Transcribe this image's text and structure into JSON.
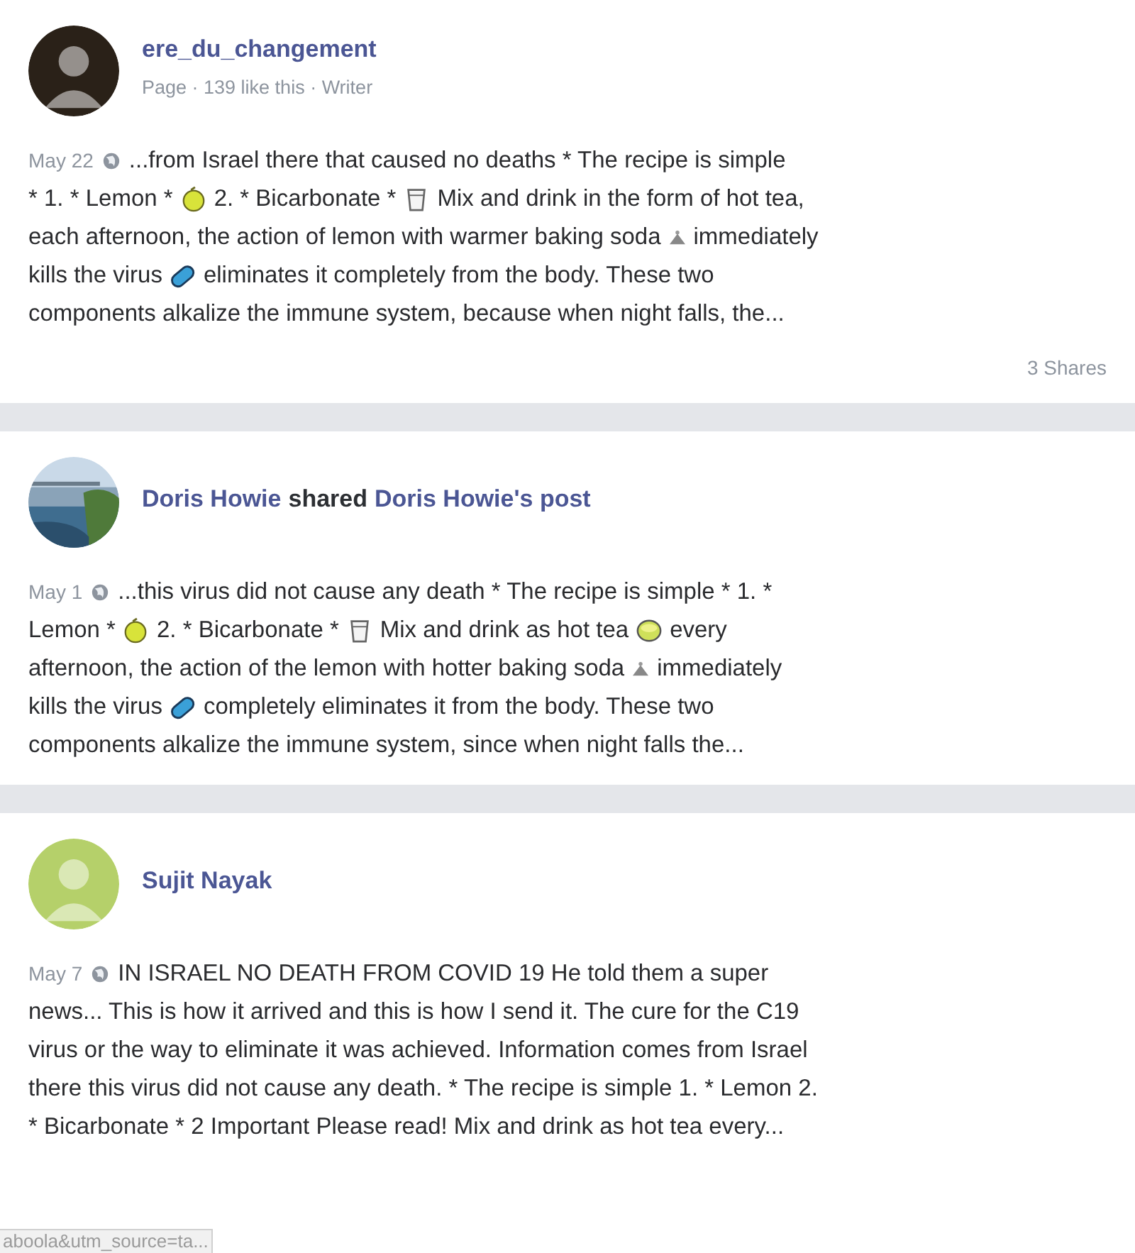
{
  "posts": [
    {
      "avatar": {
        "kind": "person",
        "color": "#2a2118"
      },
      "author": "ere_du_changement",
      "meta": "Page · 139 like this · Writer",
      "date": "May 22",
      "lines": [
        [
          {
            "kind": "text",
            "text": "...from Israel there that caused no deaths * The recipe is simple"
          }
        ],
        [
          {
            "kind": "text",
            "text": "* 1. * Lemon *"
          },
          {
            "kind": "lemon"
          },
          {
            "kind": "text",
            "text": "2. * Bicarbonate *"
          },
          {
            "kind": "glass"
          },
          {
            "kind": "text",
            "text": "Mix and drink in the form of hot tea,"
          }
        ],
        [
          {
            "kind": "text",
            "text": "each afternoon, the action of lemon with warmer baking soda"
          },
          {
            "kind": "powder"
          },
          {
            "kind": "text",
            "text": "immediately"
          }
        ],
        [
          {
            "kind": "text",
            "text": "kills the virus"
          },
          {
            "kind": "pill"
          },
          {
            "kind": "text",
            "text": "eliminates it completely from the body. These two"
          }
        ],
        [
          {
            "kind": "text",
            "text": "components alkalize the immune system, because when night falls, the..."
          }
        ]
      ],
      "shares": "3 Shares"
    },
    {
      "author": "Doris Howie",
      "shared": {
        "verb": "shared",
        "target": "Doris Howie's post"
      },
      "date": "May 1",
      "lines": [
        [
          {
            "kind": "text",
            "text": "...this virus did not cause any death * The recipe is simple * 1. *"
          }
        ],
        [
          {
            "kind": "text",
            "text": "Lemon *"
          },
          {
            "kind": "lemon"
          },
          {
            "kind": "text",
            "text": "2. * Bicarbonate *"
          },
          {
            "kind": "glass"
          },
          {
            "kind": "text",
            "text": "Mix and drink as hot tea"
          },
          {
            "kind": "bowl"
          },
          {
            "kind": "text",
            "text": "every"
          }
        ],
        [
          {
            "kind": "text",
            "text": "afternoon, the action of the lemon with hotter baking soda"
          },
          {
            "kind": "powder"
          },
          {
            "kind": "text",
            "text": "immediately"
          }
        ],
        [
          {
            "kind": "text",
            "text": "kills the virus"
          },
          {
            "kind": "pill"
          },
          {
            "kind": "text",
            "text": "completely eliminates it from the body. These two"
          }
        ],
        [
          {
            "kind": "text",
            "text": "components alkalize the immune system, since when night falls the..."
          }
        ]
      ]
    },
    {
      "avatar": {
        "kind": "person",
        "color": "#b5d06a"
      },
      "author": "Sujit Nayak",
      "date": "May 7",
      "lines": [
        [
          {
            "kind": "text",
            "text": "IN ISRAEL NO DEATH FROM COVID 19 He told them a super"
          }
        ],
        [
          {
            "kind": "text",
            "text": "news... This is how it arrived and this is how I send it. The cure for the C19"
          }
        ],
        [
          {
            "kind": "text",
            "text": "virus or the way to eliminate it was achieved. Information comes from Israel"
          }
        ],
        [
          {
            "kind": "text",
            "text": "there this virus did not cause any death. * The recipe is simple 1. * Lemon 2."
          }
        ],
        [
          {
            "kind": "text",
            "text": "* Bicarbonate * 2 Important Please read! Mix and drink as hot tea every..."
          }
        ]
      ]
    }
  ],
  "status_url": "aboola&utm_source=ta..."
}
